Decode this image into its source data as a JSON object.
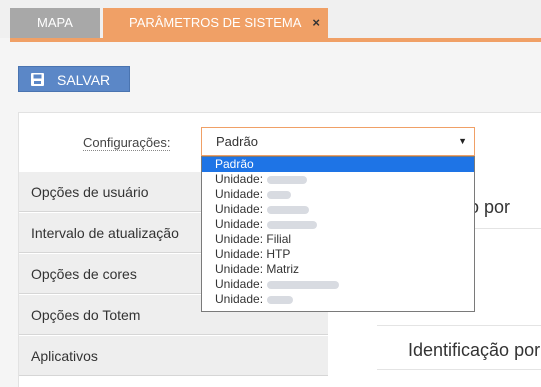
{
  "tabs": [
    {
      "label": "MAPA"
    },
    {
      "label": "PARÂMETROS DE SISTEMA",
      "close": "×"
    }
  ],
  "toolbar": {
    "save_label": "SALVAR"
  },
  "config": {
    "label": "Configurações:",
    "selected": "Padrão"
  },
  "dropdown": {
    "options": [
      {
        "text": "Padrão",
        "selected": true
      },
      {
        "text": "Unidade:"
      },
      {
        "text": "Unidade:"
      },
      {
        "text": "Unidade:"
      },
      {
        "text": "Unidade:"
      },
      {
        "text": "Unidade: Filial"
      },
      {
        "text": "Unidade: HTP"
      },
      {
        "text": "Unidade: Matriz"
      },
      {
        "text": "Unidade:"
      },
      {
        "text": "Unidade:"
      }
    ]
  },
  "nav": {
    "items": [
      {
        "label": "Opções de usuário"
      },
      {
        "label": "Intervalo de atualização"
      },
      {
        "label": "Opções de cores"
      },
      {
        "label": "Opções do Totem"
      },
      {
        "label": "Aplicativos"
      }
    ]
  },
  "content": {
    "heading_1": "ação por",
    "heading_2": "Identificação por"
  },
  "colors": {
    "accent": "#f0a066",
    "button": "#5b87c7",
    "selection": "#1e74e6"
  }
}
